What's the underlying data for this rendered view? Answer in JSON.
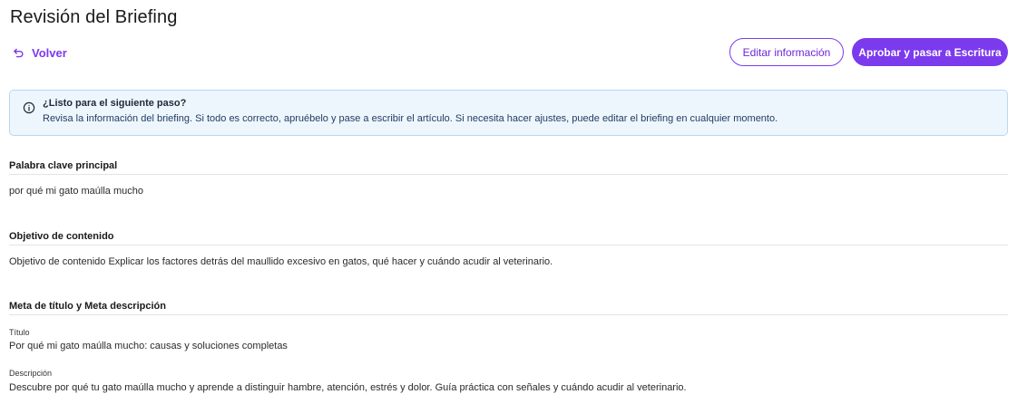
{
  "page": {
    "title": "Revisión del Briefing"
  },
  "toolbar": {
    "back_label": "Volver",
    "edit_label": "Editar información",
    "approve_label": "Aprobar y pasar a Escritura"
  },
  "alert": {
    "title": "¿Listo para el siguiente paso?",
    "body": "Revisa la información del briefing. Si todo es correcto, apruébelo y pase a escribir el artículo. Si necesita hacer ajustes, puede editar el briefing en cualquier momento."
  },
  "sections": {
    "keyword": {
      "heading": "Palabra clave principal",
      "value": "por qué mi gato maúlla mucho"
    },
    "objective": {
      "heading": "Objetivo de contenido",
      "value": "Objetivo de contenido Explicar los factores detrás del maullido excesivo en gatos, qué hacer y cuándo acudir al veterinario."
    },
    "meta": {
      "heading": "Meta de título y Meta descripción",
      "title_label": "Título",
      "title_value": "Por qué mi gato maúlla mucho: causas y soluciones completas",
      "description_label": "Descripción",
      "description_value": "Descubre por qué tu gato maúlla mucho y aprende a distinguir hambre, atención, estrés y dolor. Guía práctica con señales y cuándo acudir al veterinario."
    }
  },
  "colors": {
    "accent": "#7c3aed",
    "alert_bg": "#eef6fd",
    "alert_border": "#b8d8f2"
  },
  "icons": {
    "back": "undo-arrow-icon",
    "info": "info-circle-icon"
  }
}
